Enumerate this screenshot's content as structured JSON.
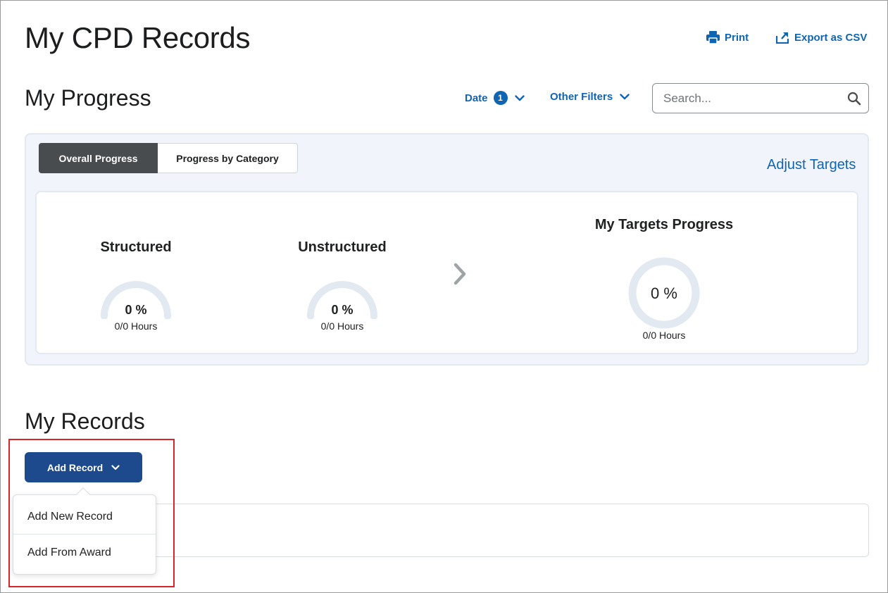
{
  "header": {
    "title": "My CPD Records",
    "print_label": "Print",
    "export_label": "Export as CSV"
  },
  "progress": {
    "title": "My Progress",
    "filters": {
      "date_label": "Date",
      "date_count": "1",
      "other_label": "Other Filters"
    },
    "search": {
      "placeholder": "Search..."
    },
    "tabs": [
      {
        "label": "Overall Progress",
        "selected": true
      },
      {
        "label": "Progress by Category",
        "selected": false
      }
    ],
    "adjust_targets_label": "Adjust Targets",
    "stats": {
      "structured": {
        "label": "Structured",
        "percent": "0 %",
        "hours": "0/0 Hours",
        "value": 0
      },
      "unstructured": {
        "label": "Unstructured",
        "percent": "0 %",
        "hours": "0/0 Hours",
        "value": 0
      },
      "targets": {
        "label": "My Targets Progress",
        "percent": "0 %",
        "hours": "0/0 Hours",
        "value": 0
      }
    }
  },
  "records": {
    "title": "My Records",
    "add_button_label": "Add Record",
    "menu_items": [
      {
        "label": "Add New Record"
      },
      {
        "label": "Add From Award"
      }
    ]
  },
  "colors": {
    "link": "#1065b3",
    "primary_button": "#1c4a8c",
    "selected_tab": "#494c4e",
    "panel_bg": "#f1f5fb",
    "gauge_track": "#e3e9f1",
    "highlight": "#d6252b"
  }
}
